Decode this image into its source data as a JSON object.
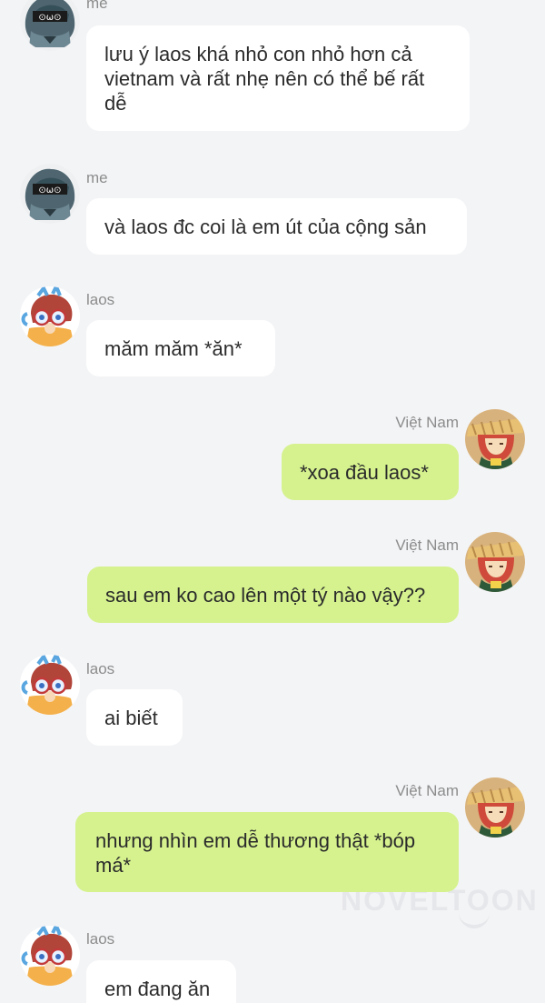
{
  "chat": {
    "messages": [
      {
        "sender": "me",
        "text": "lưu ý laos khá nhỏ con nhỏ hơn cả vietnam và rất nhẹ nên có thể bế rất dễ",
        "side": "left",
        "avatar": "me-avatar"
      },
      {
        "sender": "me",
        "text": "và laos đc coi là em út của cộng sản",
        "side": "left",
        "avatar": "me-avatar"
      },
      {
        "sender": "laos",
        "text": "măm măm *ăn*",
        "side": "left",
        "avatar": "laos-avatar"
      },
      {
        "sender": "Việt Nam",
        "text": "*xoa đầu laos*",
        "side": "right",
        "avatar": "vietnam-avatar"
      },
      {
        "sender": "Việt Nam",
        "text": "sau em ko cao lên một tý nào vậy??",
        "side": "right",
        "avatar": "vietnam-avatar"
      },
      {
        "sender": "laos",
        "text": "ai biết",
        "side": "left",
        "avatar": "laos-avatar"
      },
      {
        "sender": "Việt Nam",
        "text": "nhưng nhìn em dễ thương thật *bóp má*",
        "side": "right",
        "avatar": "vietnam-avatar"
      },
      {
        "sender": "laos",
        "text": "em đang ăn",
        "side": "left",
        "avatar": "laos-avatar"
      }
    ]
  },
  "watermark": "NOVELTOON",
  "colors": {
    "background": "#f3f4f6",
    "incoming_bubble": "#ffffff",
    "outgoing_bubble": "#d5f28e",
    "name_text": "#8c8c8c",
    "message_text": "#2b2b2b"
  }
}
